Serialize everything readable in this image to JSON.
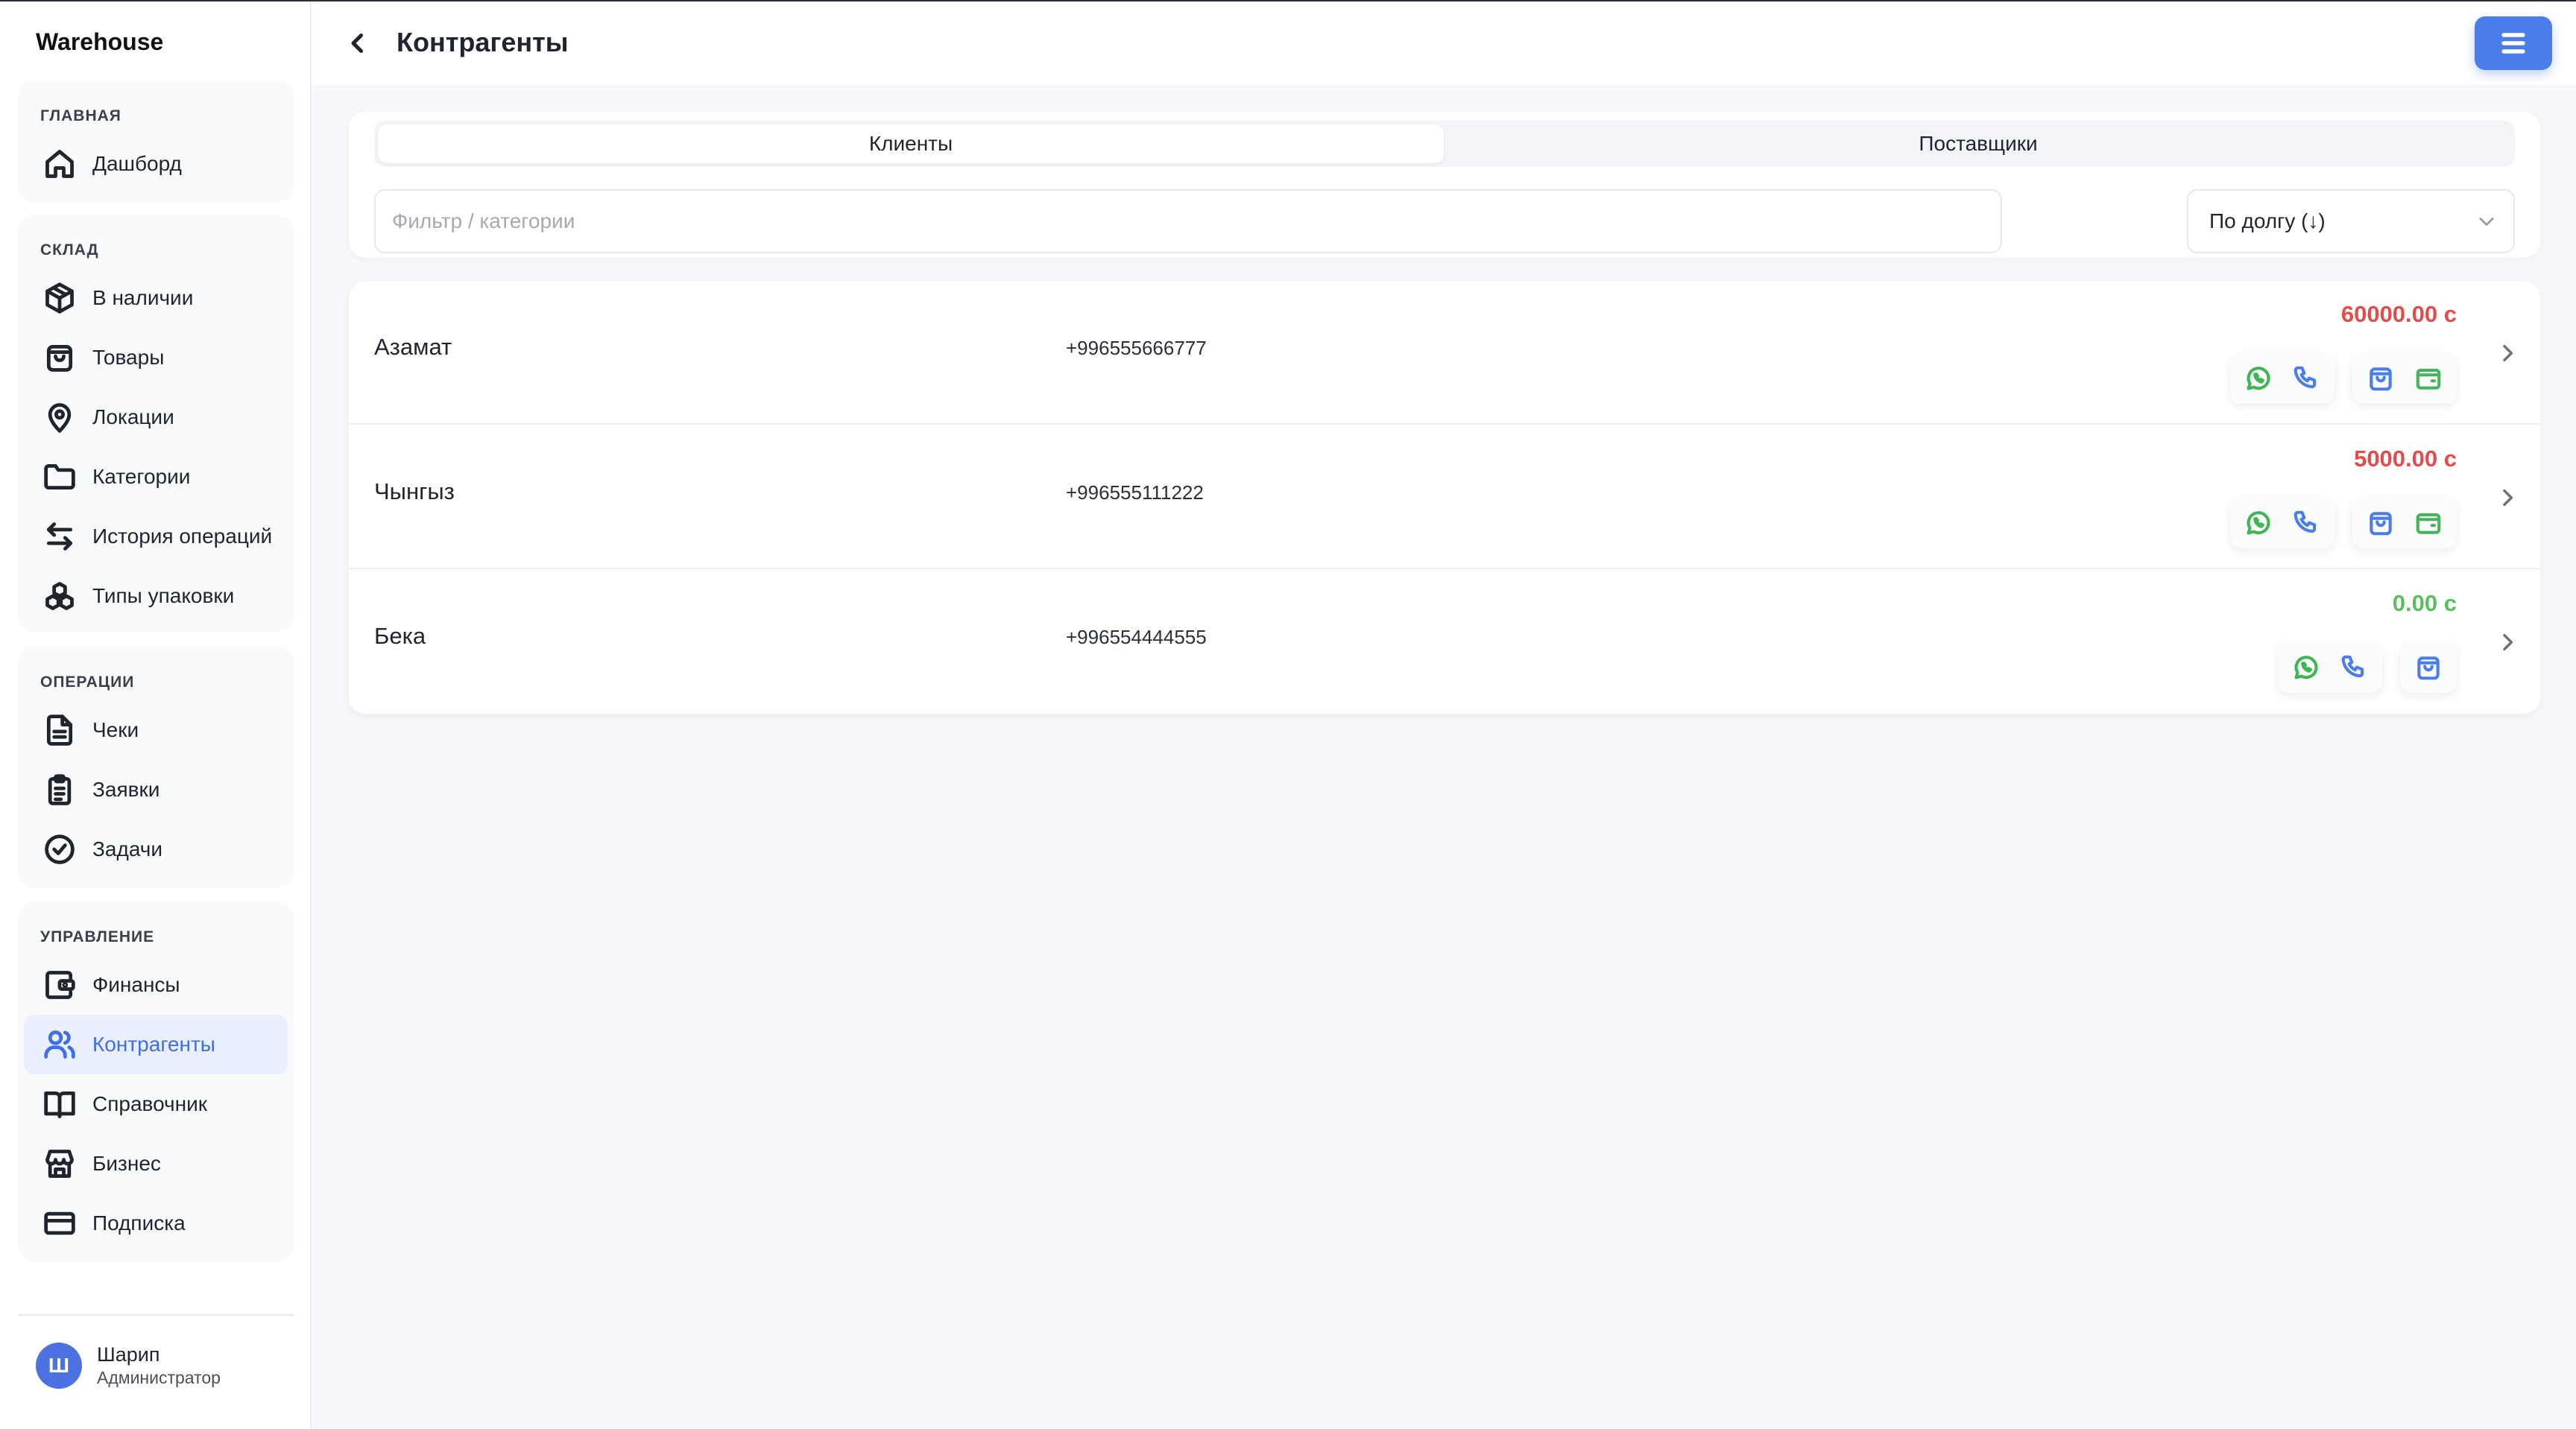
{
  "app": {
    "brand": "Warehouse"
  },
  "sidebar": {
    "groups": [
      {
        "title": "ГЛАВНАЯ",
        "items": [
          {
            "label": "Дашборд",
            "icon": "home-icon"
          }
        ]
      },
      {
        "title": "СКЛАД",
        "items": [
          {
            "label": "В наличии",
            "icon": "box-icon"
          },
          {
            "label": "Товары",
            "icon": "bag-icon"
          },
          {
            "label": "Локации",
            "icon": "map-pin-icon"
          },
          {
            "label": "Категории",
            "icon": "folder-icon"
          },
          {
            "label": "История операций",
            "icon": "arrows-swap-icon"
          },
          {
            "label": "Типы упаковки",
            "icon": "boxes-icon"
          }
        ]
      },
      {
        "title": "ОПЕРАЦИИ",
        "items": [
          {
            "label": "Чеки",
            "icon": "document-icon"
          },
          {
            "label": "Заявки",
            "icon": "clipboard-icon"
          },
          {
            "label": "Задачи",
            "icon": "check-circle-icon"
          }
        ]
      },
      {
        "title": "УПРАВЛЕНИЕ",
        "items": [
          {
            "label": "Финансы",
            "icon": "wallet-icon"
          },
          {
            "label": "Контрагенты",
            "icon": "users-icon",
            "active": true
          },
          {
            "label": "Справочник",
            "icon": "book-icon"
          },
          {
            "label": "Бизнес",
            "icon": "store-icon"
          },
          {
            "label": "Подписка",
            "icon": "credit-card-icon"
          }
        ]
      }
    ],
    "user": {
      "initial": "Ш",
      "name": "Шарип",
      "role": "Администратор"
    }
  },
  "header": {
    "title": "Контрагенты"
  },
  "tabs": [
    {
      "label": "Клиенты",
      "active": true
    },
    {
      "label": "Поставщики",
      "active": false
    }
  ],
  "filter": {
    "placeholder": "Фильтр / категории",
    "value": ""
  },
  "sort": {
    "label": "По долгу (↓)"
  },
  "contacts": [
    {
      "name": "Азамат",
      "phone": "+996555666777",
      "debt": "60000.00 с",
      "debt_status": "red",
      "has_wallet": true
    },
    {
      "name": "Чынгыз",
      "phone": "+996555111222",
      "debt": "5000.00 с",
      "debt_status": "red",
      "has_wallet": true
    },
    {
      "name": "Бека",
      "phone": "+996554444555",
      "debt": "0.00 с",
      "debt_status": "green",
      "has_wallet": false
    }
  ],
  "colors": {
    "accent": "#4a7de8",
    "debt_red": "#e24c4c",
    "debt_green": "#5bbd5e",
    "whatsapp": "#3fb554"
  }
}
